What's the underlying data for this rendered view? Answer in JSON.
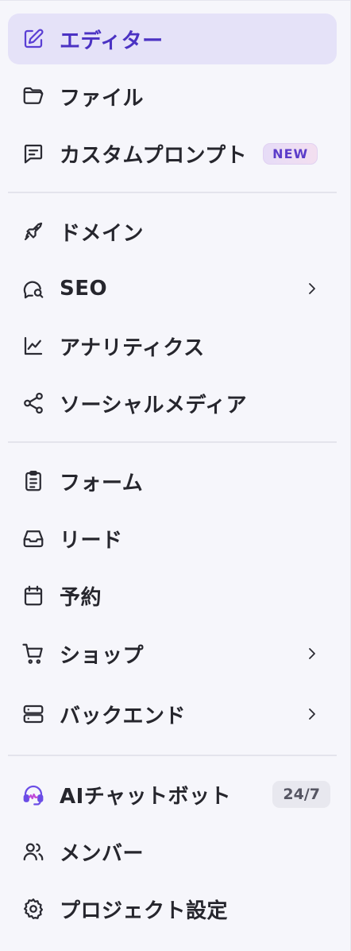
{
  "menu": {
    "editor": {
      "label": "エディター",
      "icon": "edit-icon"
    },
    "files": {
      "label": "ファイル",
      "icon": "folder-icon"
    },
    "custom_prompt": {
      "label": "カスタムプロンプト",
      "icon": "message-text-icon",
      "badge": "NEW"
    },
    "domain": {
      "label": "ドメイン",
      "icon": "rocket-icon"
    },
    "seo": {
      "label": "SEO",
      "icon": "search-chat-icon"
    },
    "analytics": {
      "label": "アナリティクス",
      "icon": "line-chart-icon"
    },
    "social_media": {
      "label": "ソーシャルメディア",
      "icon": "share-icon"
    },
    "forms": {
      "label": "フォーム",
      "icon": "clipboard-icon"
    },
    "leads": {
      "label": "リード",
      "icon": "inbox-icon"
    },
    "booking": {
      "label": "予約",
      "icon": "calendar-icon"
    },
    "shop": {
      "label": "ショップ",
      "icon": "cart-icon"
    },
    "backend": {
      "label": "バックエンド",
      "icon": "server-icon"
    },
    "ai_chatbot": {
      "label": "AIチャットボット",
      "icon": "headset-icon",
      "badge": "24/7"
    },
    "members": {
      "label": "メンバー",
      "icon": "users-icon"
    },
    "project_settings": {
      "label": "プロジェクト設定",
      "icon": "gear-icon"
    }
  },
  "colors": {
    "active_bg": "#e5e2f8",
    "active_text": "#4b32c3",
    "accent": "#5a3fd4",
    "background": "#f6f6fb"
  }
}
